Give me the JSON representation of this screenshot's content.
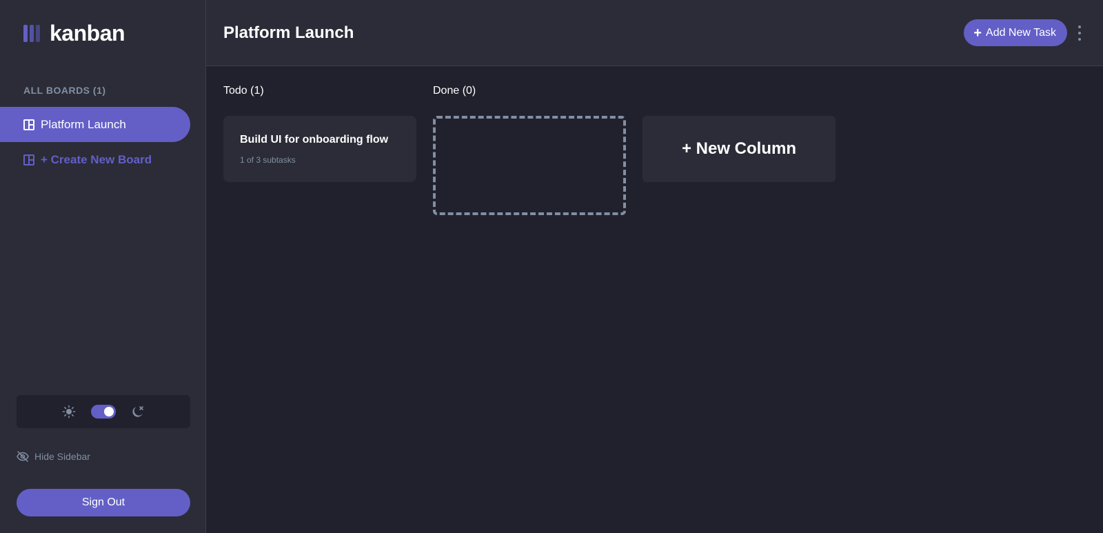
{
  "app": {
    "logo_text": "kanban",
    "brand_color": "#635fc7"
  },
  "sidebar": {
    "boards_heading": "ALL BOARDS (1)",
    "boards": [
      {
        "label": "Platform Launch",
        "icon": "board-icon",
        "active": true
      }
    ],
    "create_board_label": "+ Create New Board",
    "theme": {
      "sun_icon": "sun-icon",
      "moon_icon": "moon-icon",
      "dark_mode": true
    },
    "hide_sidebar_label": "Hide Sidebar",
    "sign_out_label": "Sign Out"
  },
  "header": {
    "title": "Platform Launch",
    "add_task_label": "Add New Task"
  },
  "board": {
    "columns": [
      {
        "title": "Todo (1)",
        "tasks": [
          {
            "title": "Build UI for onboarding flow",
            "subtasks": "1 of 3 subtasks"
          }
        ]
      },
      {
        "title": "Done (0)",
        "tasks": []
      }
    ],
    "new_column_label": "+ New Column"
  }
}
